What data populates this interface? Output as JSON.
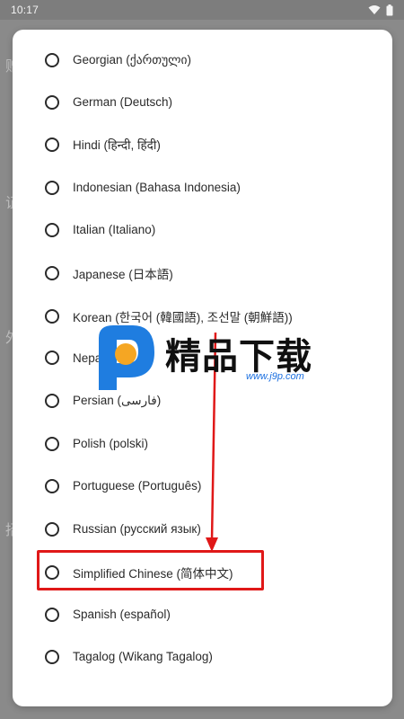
{
  "status_bar": {
    "time": "10:17",
    "icons": [
      "wifi-icon",
      "battery-icon"
    ]
  },
  "background": {
    "partial_chars": [
      "赠",
      "证",
      "外",
      "招"
    ]
  },
  "dialog": {
    "languages": [
      {
        "label": "Georgian (ქართული)"
      },
      {
        "label": "German (Deutsch)"
      },
      {
        "label": "Hindi (हिन्दी, हिंदी)"
      },
      {
        "label": "Indonesian (Bahasa Indonesia)"
      },
      {
        "label": "Italian (Italiano)"
      },
      {
        "label": "Japanese (日本語)"
      },
      {
        "label": "Korean (한국어 (韓國語), 조선말 (朝鮮語))"
      },
      {
        "label": "Nepali (नेपाली)"
      },
      {
        "label": "Persian (فارسی)"
      },
      {
        "label": "Polish (polski)"
      },
      {
        "label": "Portuguese (Português)"
      },
      {
        "label": "Russian (русский язык)"
      },
      {
        "label": "Simplified Chinese (简体中文)"
      },
      {
        "label": "Spanish (español)"
      },
      {
        "label": "Tagalog (Wikang Tagalog)"
      }
    ],
    "highlighted_label": "Simplified Chinese (简体中文)"
  },
  "annotation": {
    "color": "#e01818"
  },
  "watermark": {
    "title": "精品下载",
    "url": "www.j9p.com"
  }
}
